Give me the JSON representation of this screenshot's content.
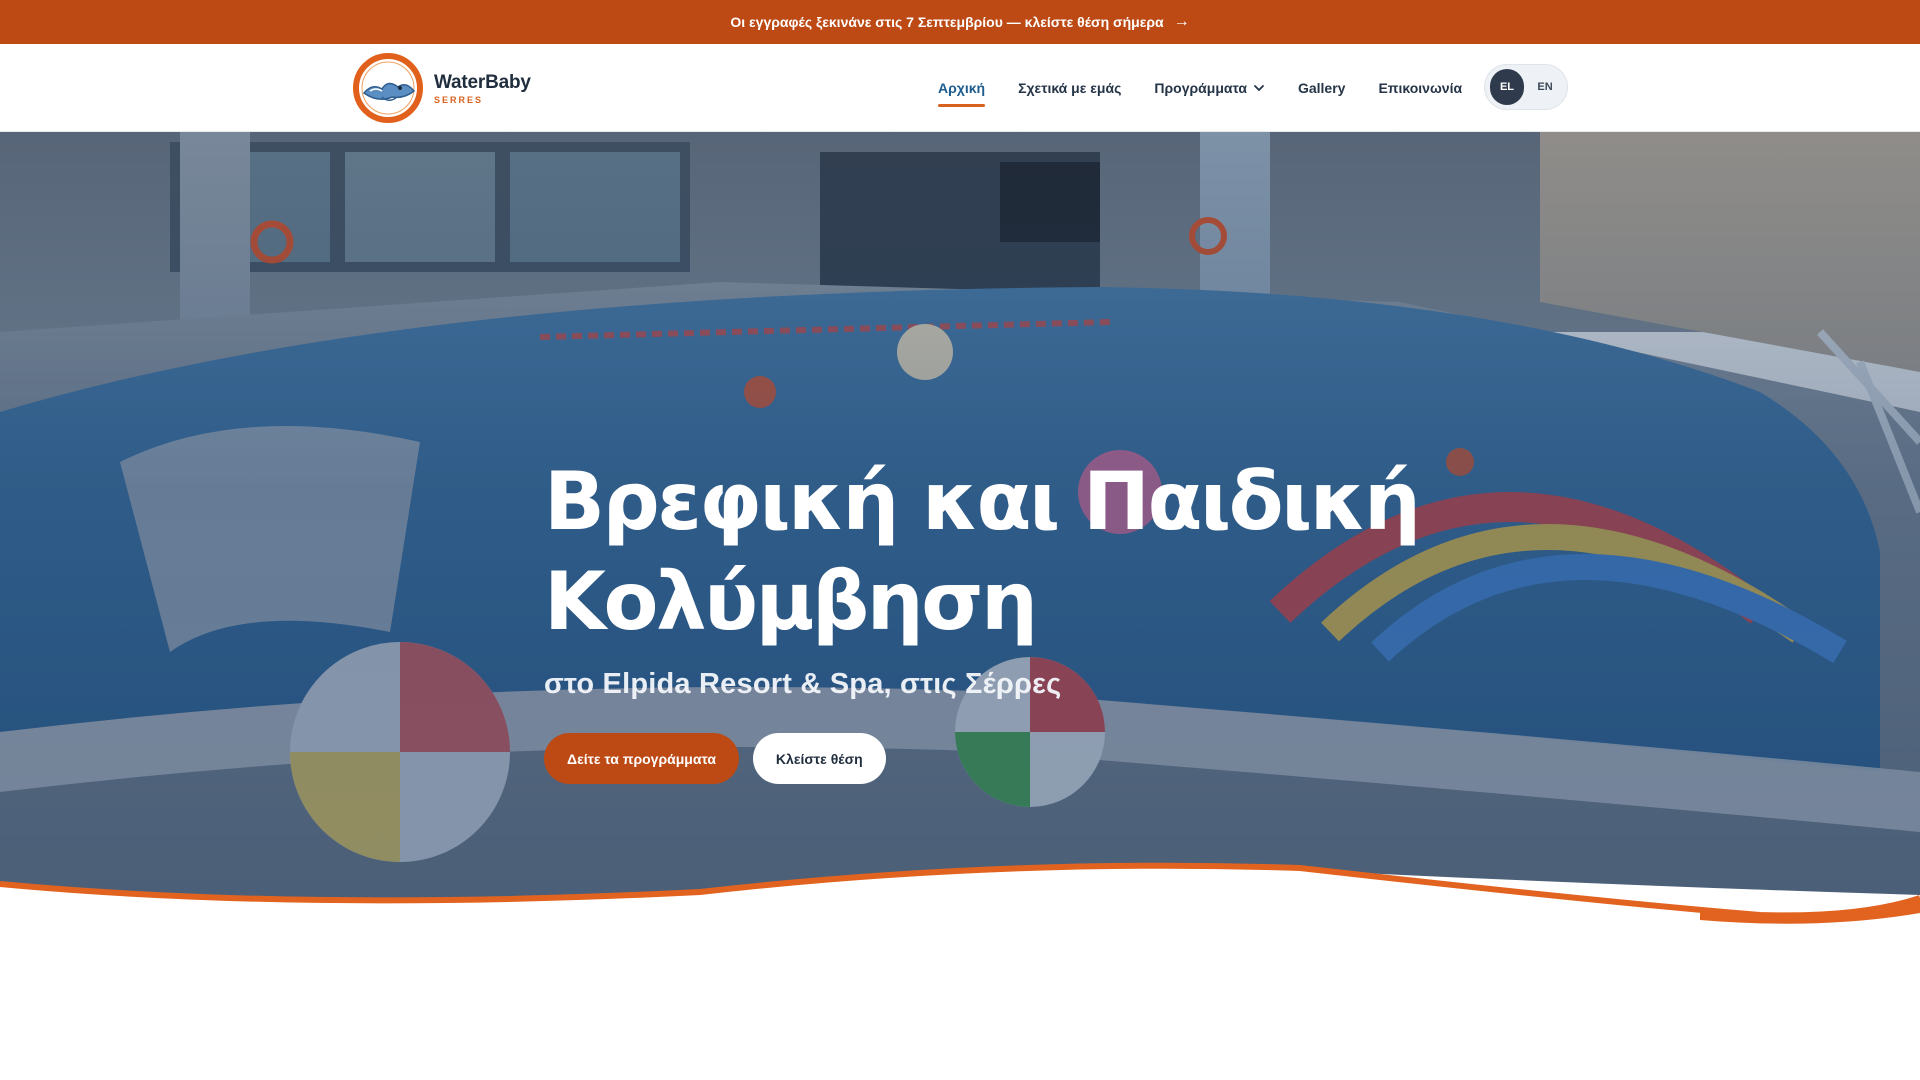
{
  "announcement": {
    "text": "Οι εγγραφές ξεκινάνε στις 7 Σεπτεμβρίου — κλείστε θέση σήμερα",
    "arrow_icon": "arrow-right-icon"
  },
  "brand": {
    "name": "WaterBaby",
    "sub": "SERRES",
    "badge_top": "WaterBaby",
    "badge_bottom": "SERRES"
  },
  "nav": {
    "items": [
      {
        "label": "Αρχική"
      },
      {
        "label": "Σχετικά με εμάς"
      },
      {
        "label": "Προγράμματα"
      },
      {
        "label": "Gallery"
      },
      {
        "label": "Επικοινωνία"
      }
    ]
  },
  "lang": {
    "el": "EL",
    "en": "EN",
    "active": "EL"
  },
  "hero": {
    "title_line1": "Βρεφική και Παιδική",
    "title_line2": "Κολύμβηση",
    "subtitle": "στο Elpida Resort & Spa, στις Σέρρες",
    "primary_cta": "Δείτε τα προγράμματα",
    "secondary_cta": "Κλείστε θέση"
  },
  "colors": {
    "accent": "#bd4a14",
    "accent_light": "#d8621d",
    "nav_active": "#1d5d8f",
    "text_dark": "#1f2d3d"
  }
}
